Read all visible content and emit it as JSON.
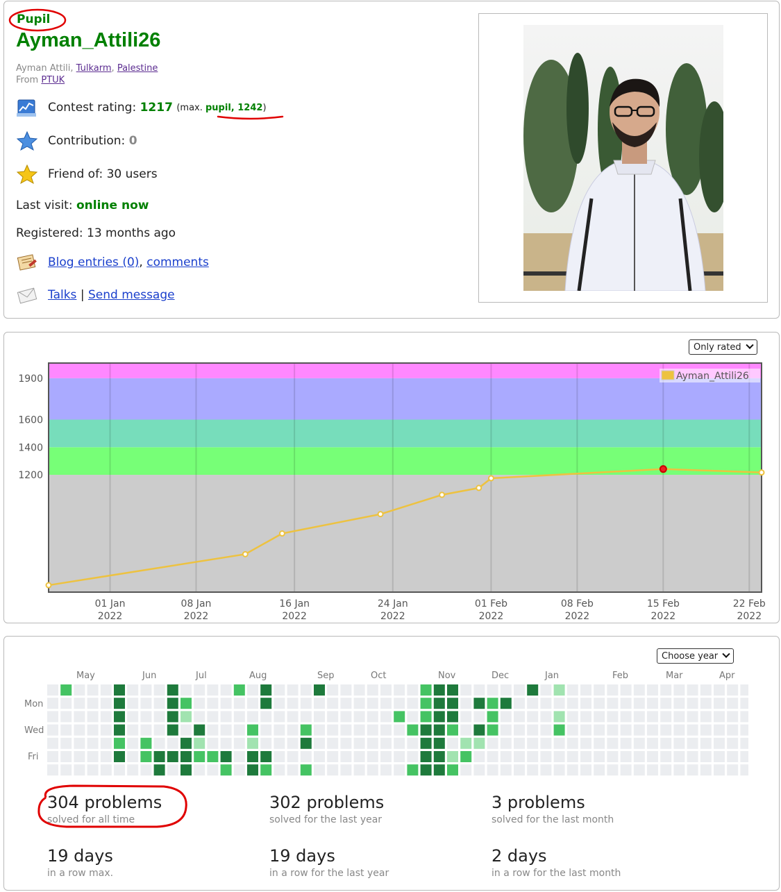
{
  "profile": {
    "rank": "Pupil",
    "handle": "Ayman_Attili26",
    "name": "Ayman Attili",
    "city": "Tulkarm",
    "country": "Palestine",
    "from_label": "From",
    "organization": "PTUK",
    "rating_label": "Contest rating:",
    "rating": "1217",
    "max_prefix": "(max.",
    "max_value": "pupil, 1242",
    "max_suffix": ")",
    "contribution_label": "Contribution:",
    "contribution": "0",
    "friend_label": "Friend of: 30 users",
    "last_visit_label": "Last visit:",
    "last_visit": "online now",
    "registered": "Registered: 13 months ago",
    "blog_link": "Blog entries (0)",
    "comments_link": "comments",
    "talks_link": "Talks",
    "separator": "|",
    "send_message_link": "Send message",
    "colors": {
      "rank_green": "#008000",
      "link_blue": "#1a3fcc",
      "annotation_red": "#e00000"
    },
    "icons": [
      "rating-chart-icon",
      "contribution-star-icon",
      "friend-star-icon",
      "blog-icon",
      "talks-envelope-icon"
    ]
  },
  "rating_graph": {
    "filter_select": "Only rated",
    "chart_data": {
      "type": "line",
      "series": [
        {
          "name": "Ayman_Attili26",
          "color": "#edc240",
          "x": [
            "2021-12-27",
            "2022-01-12",
            "2022-01-15",
            "2022-01-23",
            "2022-01-28",
            "2022-01-31",
            "2022-02-01",
            "2022-02-15",
            "2022-02-23"
          ],
          "y": [
            400,
            625,
            775,
            915,
            1055,
            1105,
            1175,
            1242,
            1217
          ]
        }
      ],
      "max_point": {
        "x": "2022-02-15",
        "y": 1242
      },
      "y_ticks": [
        1200,
        1400,
        1600,
        1900
      ],
      "ylim": [
        350,
        2010
      ],
      "x_ticks": [
        {
          "date": "2022-01-01",
          "l1": "01 Jan",
          "l2": "2022"
        },
        {
          "date": "2022-01-08",
          "l1": "08 Jan",
          "l2": "2022"
        },
        {
          "date": "2022-01-16",
          "l1": "16 Jan",
          "l2": "2022"
        },
        {
          "date": "2022-01-24",
          "l1": "24 Jan",
          "l2": "2022"
        },
        {
          "date": "2022-02-01",
          "l1": "01 Feb",
          "l2": "2022"
        },
        {
          "date": "2022-02-08",
          "l1": "08 Feb",
          "l2": "2022"
        },
        {
          "date": "2022-02-15",
          "l1": "15 Feb",
          "l2": "2022"
        },
        {
          "date": "2022-02-22",
          "l1": "22 Feb",
          "l2": "2022"
        }
      ],
      "xlim": [
        "2021-12-27",
        "2022-02-23"
      ],
      "bands": [
        {
          "from": 350,
          "to": 1200,
          "color": "#cccccc"
        },
        {
          "from": 1200,
          "to": 1400,
          "color": "#77ff77"
        },
        {
          "from": 1400,
          "to": 1600,
          "color": "#77ddbb"
        },
        {
          "from": 1600,
          "to": 1900,
          "color": "#aaaaff"
        },
        {
          "from": 1900,
          "to": 2010,
          "color": "#ff88ff"
        }
      ],
      "grid": true,
      "legend": "top-right"
    }
  },
  "activity": {
    "year_select": "Choose year",
    "months": [
      "May",
      "Jun",
      "Jul",
      "Aug",
      "Sep",
      "Oct",
      "Nov",
      "Dec",
      "Jan",
      "Feb",
      "Mar",
      "Apr"
    ],
    "days": [
      "Mon",
      "Wed",
      "Fri"
    ],
    "heatmap": {
      "weeks": 53,
      "levels": {
        "2": "#1e7a3c",
        "1": "#45c363",
        "0.5": "#a1e3b0",
        "0": "#ebedf0"
      },
      "cells": [
        [
          1,
          0,
          1
        ],
        [
          5,
          0,
          2
        ],
        [
          5,
          1,
          2
        ],
        [
          5,
          2,
          2
        ],
        [
          5,
          3,
          2
        ],
        [
          5,
          4,
          1
        ],
        [
          5,
          5,
          2
        ],
        [
          7,
          4,
          1
        ],
        [
          7,
          5,
          1
        ],
        [
          8,
          5,
          2
        ],
        [
          8,
          6,
          2
        ],
        [
          9,
          0,
          2
        ],
        [
          9,
          1,
          2
        ],
        [
          9,
          2,
          2
        ],
        [
          9,
          3,
          2
        ],
        [
          9,
          5,
          2
        ],
        [
          10,
          1,
          1
        ],
        [
          10,
          2,
          0.5
        ],
        [
          10,
          4,
          2
        ],
        [
          10,
          5,
          2
        ],
        [
          10,
          6,
          2
        ],
        [
          11,
          3,
          2
        ],
        [
          11,
          4,
          0.5
        ],
        [
          11,
          5,
          1
        ],
        [
          12,
          5,
          1
        ],
        [
          13,
          5,
          2
        ],
        [
          13,
          6,
          1
        ],
        [
          14,
          0,
          1
        ],
        [
          15,
          3,
          1
        ],
        [
          15,
          4,
          0.5
        ],
        [
          15,
          5,
          2
        ],
        [
          15,
          6,
          2
        ],
        [
          16,
          0,
          2
        ],
        [
          16,
          1,
          2
        ],
        [
          16,
          5,
          2
        ],
        [
          16,
          6,
          1
        ],
        [
          19,
          3,
          1
        ],
        [
          19,
          4,
          2
        ],
        [
          19,
          6,
          1
        ],
        [
          20,
          0,
          2
        ],
        [
          26,
          2,
          1
        ],
        [
          27,
          3,
          1
        ],
        [
          27,
          6,
          1
        ],
        [
          28,
          0,
          1
        ],
        [
          28,
          1,
          1
        ],
        [
          28,
          2,
          1
        ],
        [
          28,
          3,
          2
        ],
        [
          28,
          4,
          2
        ],
        [
          28,
          5,
          2
        ],
        [
          28,
          6,
          2
        ],
        [
          29,
          0,
          2
        ],
        [
          29,
          1,
          2
        ],
        [
          29,
          2,
          2
        ],
        [
          29,
          3,
          2
        ],
        [
          29,
          4,
          2
        ],
        [
          29,
          5,
          2
        ],
        [
          29,
          6,
          2
        ],
        [
          30,
          0,
          2
        ],
        [
          30,
          1,
          2
        ],
        [
          30,
          2,
          2
        ],
        [
          30,
          3,
          1
        ],
        [
          30,
          5,
          0.5
        ],
        [
          30,
          6,
          1
        ],
        [
          31,
          4,
          0.5
        ],
        [
          31,
          5,
          1
        ],
        [
          32,
          1,
          2
        ],
        [
          32,
          3,
          2
        ],
        [
          32,
          4,
          0.5
        ],
        [
          33,
          1,
          1
        ],
        [
          33,
          2,
          1
        ],
        [
          33,
          3,
          1
        ],
        [
          34,
          1,
          2
        ],
        [
          36,
          0,
          2
        ],
        [
          38,
          0,
          0.5
        ],
        [
          38,
          2,
          0.5
        ],
        [
          38,
          3,
          1
        ]
      ]
    },
    "stats": [
      {
        "value": "304 problems",
        "label": "solved for all time"
      },
      {
        "value": "302 problems",
        "label": "solved for the last year"
      },
      {
        "value": "3 problems",
        "label": "solved for the last month"
      },
      {
        "value": "19 days",
        "label": "in a row max."
      },
      {
        "value": "19 days",
        "label": "in a row for the last year"
      },
      {
        "value": "2 days",
        "label": "in a row for the last month"
      }
    ]
  }
}
